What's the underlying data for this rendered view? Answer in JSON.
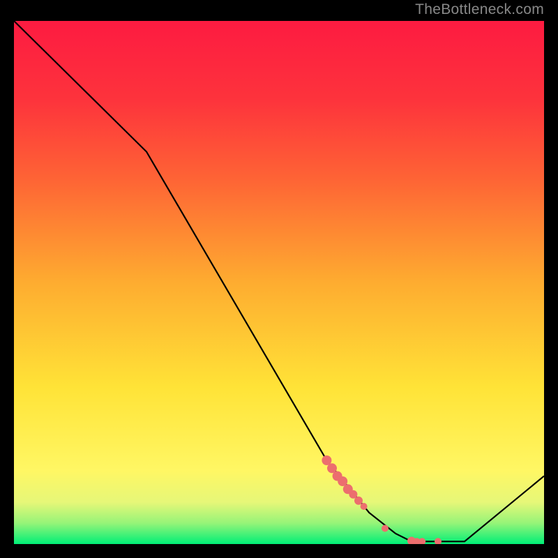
{
  "watermark": "TheBottleneck.com",
  "chart_data": {
    "type": "line",
    "title": "",
    "xlabel": "",
    "ylabel": "",
    "xlim": [
      0,
      100
    ],
    "ylim": [
      0,
      100
    ],
    "background_gradient": {
      "stops": [
        {
          "offset": 0,
          "color": "rgb(0,239,119)"
        },
        {
          "offset": 0.04,
          "color": "rgb(150,244,120)"
        },
        {
          "offset": 0.08,
          "color": "rgb(230,247,120)"
        },
        {
          "offset": 0.14,
          "color": "rgb(255,247,100)"
        },
        {
          "offset": 0.3,
          "color": "rgb(255,227,55)"
        },
        {
          "offset": 0.5,
          "color": "rgb(254,172,48)"
        },
        {
          "offset": 0.7,
          "color": "rgb(254,99,53)"
        },
        {
          "offset": 0.85,
          "color": "rgb(253,51,60)"
        },
        {
          "offset": 1.0,
          "color": "rgb(253,27,65)"
        }
      ]
    },
    "series": [
      {
        "name": "bottleneck-curve",
        "x": [
          0,
          25,
          59,
          67,
          72,
          75,
          79,
          85,
          100
        ],
        "y": [
          100,
          75,
          16,
          6,
          2,
          0.5,
          0.5,
          0.5,
          13
        ]
      }
    ],
    "highlight_points": [
      {
        "x": 59,
        "y": 16,
        "size": 7
      },
      {
        "x": 60,
        "y": 14.5,
        "size": 7
      },
      {
        "x": 61,
        "y": 13,
        "size": 7
      },
      {
        "x": 62,
        "y": 12,
        "size": 7
      },
      {
        "x": 63,
        "y": 10.5,
        "size": 7
      },
      {
        "x": 64,
        "y": 9.5,
        "size": 6
      },
      {
        "x": 65,
        "y": 8.3,
        "size": 6
      },
      {
        "x": 66,
        "y": 7.2,
        "size": 5
      },
      {
        "x": 70,
        "y": 3,
        "size": 5
      },
      {
        "x": 75,
        "y": 0.6,
        "size": 6
      },
      {
        "x": 76,
        "y": 0.5,
        "size": 5
      },
      {
        "x": 77,
        "y": 0.5,
        "size": 5
      },
      {
        "x": 80,
        "y": 0.5,
        "size": 5
      }
    ]
  }
}
